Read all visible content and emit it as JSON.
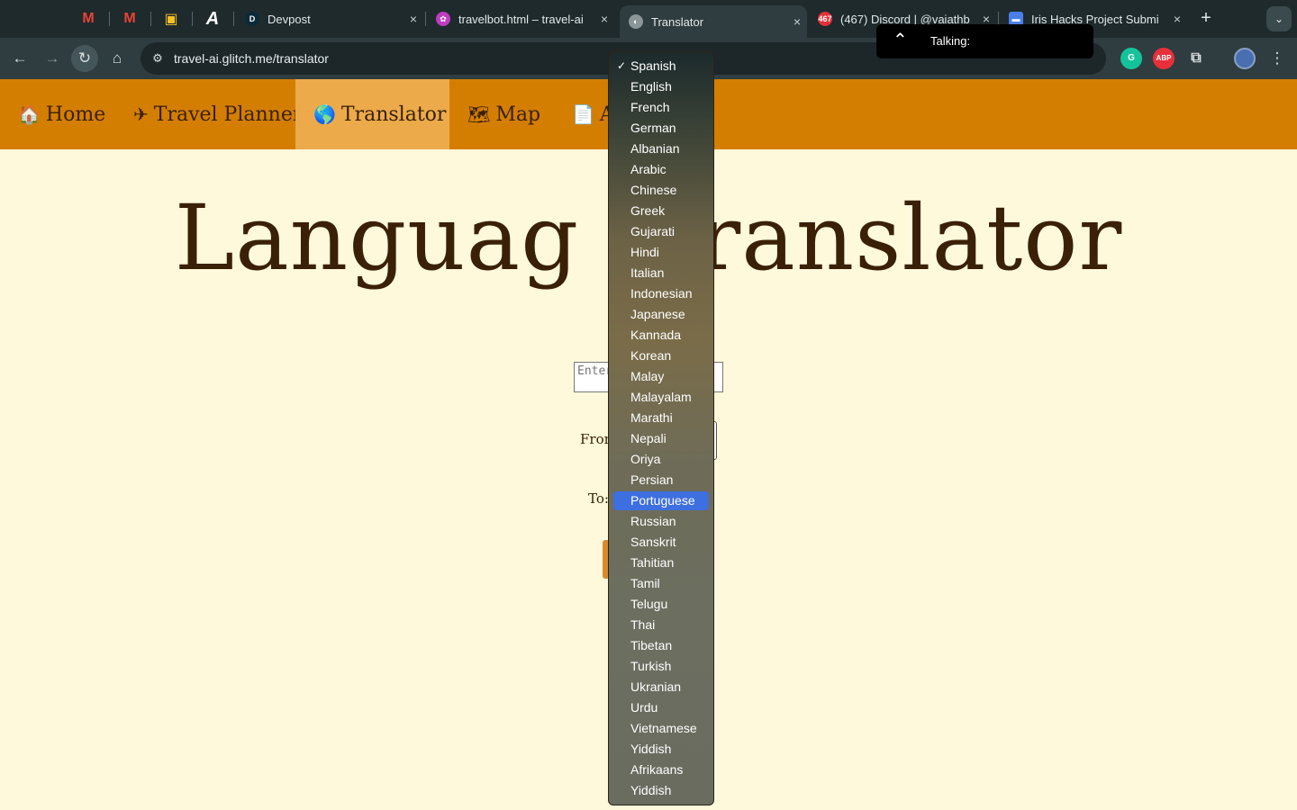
{
  "browser": {
    "pinned_tabs": [
      {
        "icon": "gmail-icon",
        "glyph": "M",
        "color": "#ea4335"
      },
      {
        "icon": "gmail-icon",
        "glyph": "M",
        "color": "#ea4335"
      },
      {
        "icon": "classroom-icon",
        "glyph": "▣",
        "color": "#f6c026"
      },
      {
        "icon": "a-logo-icon",
        "glyph": "A",
        "color": "#ffffff"
      }
    ],
    "tabs": [
      {
        "title": "Devpost",
        "favicon_glyph": "D",
        "favicon_color": "#0b2a3a"
      },
      {
        "title": "travelbot.html – travel-ai",
        "favicon_glyph": "✿",
        "favicon_color": "#c03cc0"
      },
      {
        "title": "Translator",
        "favicon_glyph": "◐",
        "favicon_color": "#8a9698",
        "active": true
      },
      {
        "title": "(467) Discord | @vaiathb",
        "favicon_glyph": "467",
        "favicon_color": "#e0313a"
      },
      {
        "title": "Iris Hacks Project Submi",
        "favicon_glyph": "▬",
        "favicon_color": "#4a7fe8"
      }
    ],
    "close_glyph": "×",
    "newtab_glyph": "+",
    "tabsearch_glyph": "⌄",
    "url": "travel-ai.glitch.me/translator",
    "toolbar_icons": {
      "back": "←",
      "forward": "→",
      "reload": "↻",
      "home": "⌂",
      "site_info": "⚙",
      "menu": "⋮"
    },
    "extensions": [
      {
        "name": "grammarly-icon",
        "glyph": "G",
        "color": "#15c39a"
      },
      {
        "name": "adblock-icon",
        "glyph": "ABP",
        "color": "#e8303a"
      },
      {
        "name": "puzzle-icon",
        "glyph": "⧉",
        "color": "#2f3d40"
      }
    ]
  },
  "talking_popup": {
    "caret": "⌃",
    "label": "Talking:"
  },
  "nav": [
    {
      "icon": "🏠",
      "label": "Home"
    },
    {
      "icon": "✈",
      "label": "Travel Planner"
    },
    {
      "icon": "🌎",
      "label": "Translator",
      "active": true
    },
    {
      "icon": "🗺",
      "label": "Map"
    },
    {
      "icon": "📄",
      "label": "A"
    }
  ],
  "main": {
    "heading": "Languag    ranslator",
    "input_placeholder": "Enter",
    "from_label": "From",
    "to_label": "To:"
  },
  "dropdown": {
    "checkmark": "✓",
    "selected_index": 0,
    "highlighted_index": 21,
    "options": [
      "Spanish",
      "English",
      "French",
      "German",
      "Albanian",
      "Arabic",
      "Chinese",
      "Greek",
      "Gujarati",
      "Hindi",
      "Italian",
      "Indonesian",
      "Japanese",
      "Kannada",
      "Korean",
      "Malay",
      "Malayalam",
      "Marathi",
      "Nepali",
      "Oriya",
      "Persian",
      "Portuguese",
      "Russian",
      "Sanskrit",
      "Tahitian",
      "Tamil",
      "Telugu",
      "Thai",
      "Tibetan",
      "Turkish",
      "Ukranian",
      "Urdu",
      "Vietnamese",
      "Yiddish",
      "Afrikaans",
      "Yiddish"
    ]
  }
}
